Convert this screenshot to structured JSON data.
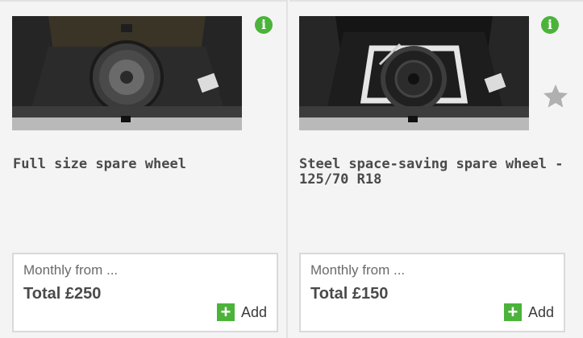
{
  "products": [
    {
      "title": "Full size spare wheel",
      "image_icon": "boot-spare-wheel-image",
      "info_icon": "info-icon",
      "monthly_label": "Monthly from ...",
      "total": "Total £250",
      "add_label": "Add"
    },
    {
      "title": "Steel space-saving spare wheel - 125/70 R18",
      "image_icon": "boot-space-saver-wheel-image",
      "info_icon": "info-icon",
      "favourite_icon": "star-icon",
      "monthly_label": "Monthly from ...",
      "total": "Total £150",
      "add_label": "Add"
    }
  ],
  "colors": {
    "accent_green": "#4bb33a",
    "star_grey": "#b0b0b0",
    "text_dark": "#4a4a4a",
    "background": "#f4f4f4"
  }
}
